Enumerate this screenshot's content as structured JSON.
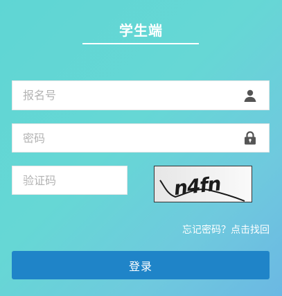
{
  "header": {
    "title": "学生端"
  },
  "form": {
    "registration_placeholder": "报名号",
    "password_placeholder": "密码",
    "captcha_placeholder": "验证码",
    "captcha_text": "n4fn",
    "forgot_link": "忘记密码？点击找回",
    "login_label": "登录"
  },
  "icons": {
    "registration": "user-icon",
    "password": "lock-icon"
  },
  "colors": {
    "accent_button": "#1f84c8",
    "background_start": "#5fd6d4",
    "background_end": "#6bb8e3"
  }
}
